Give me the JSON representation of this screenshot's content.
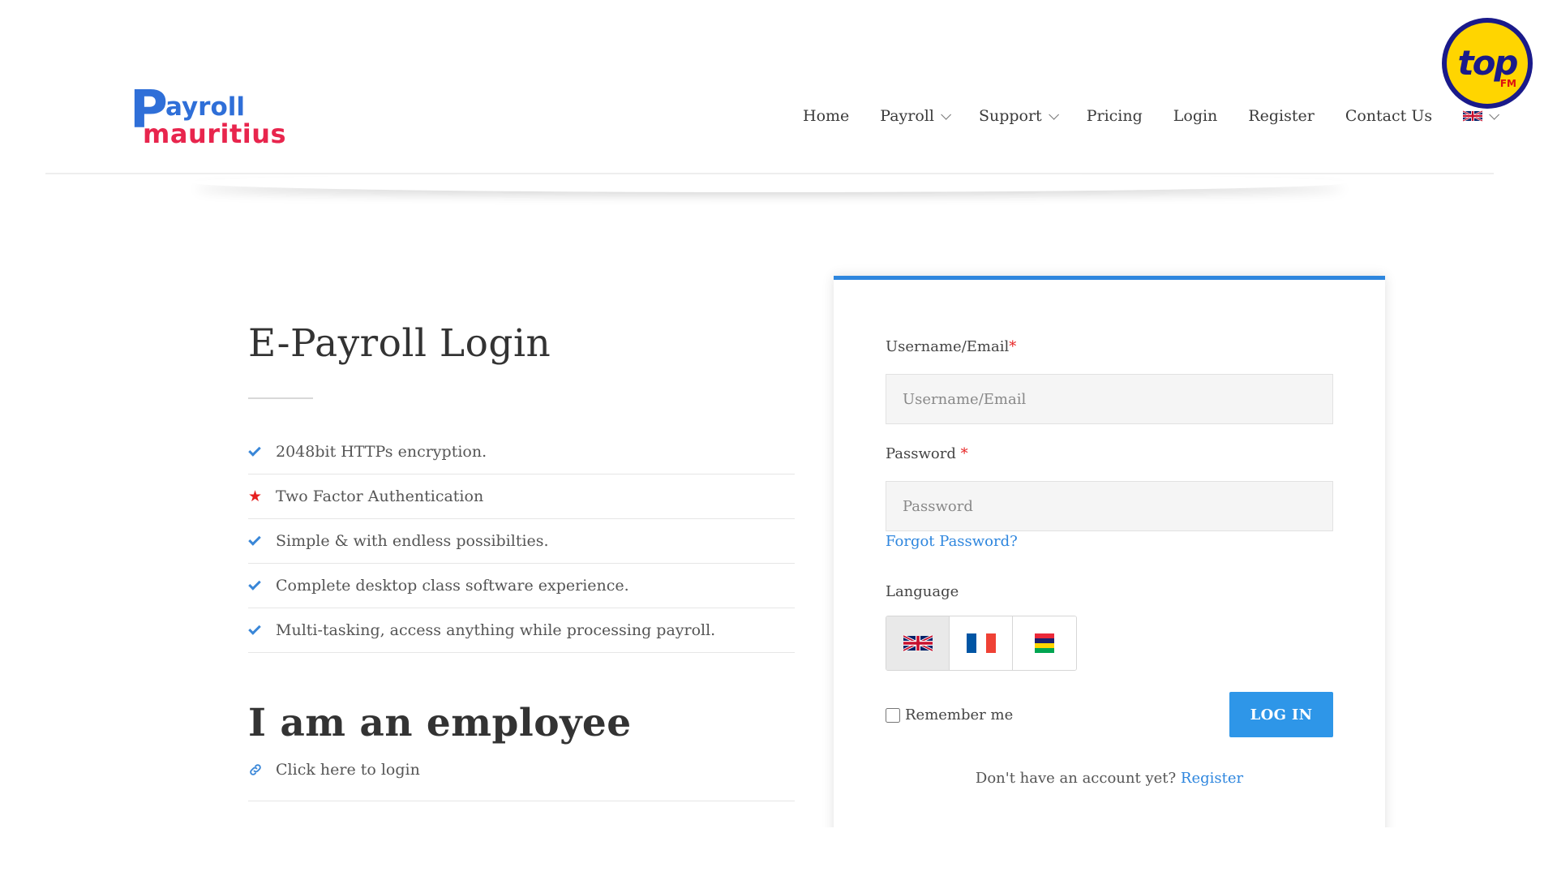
{
  "logo": {
    "letter": "P",
    "top_text": "ayroll",
    "bottom_text": "mauritius"
  },
  "nav": {
    "items": [
      {
        "label": "Home",
        "dropdown": false
      },
      {
        "label": "Payroll",
        "dropdown": true
      },
      {
        "label": "Support",
        "dropdown": true
      },
      {
        "label": "Pricing",
        "dropdown": false
      },
      {
        "label": "Login",
        "dropdown": false
      },
      {
        "label": "Register",
        "dropdown": false
      },
      {
        "label": "Contact Us",
        "dropdown": false
      }
    ],
    "language_flag": "uk-flag-icon"
  },
  "badge": {
    "text": "top",
    "subtext": "FM"
  },
  "left": {
    "title": "E-Payroll Login",
    "features": [
      {
        "icon": "check-icon",
        "text": "2048bit HTTPs encryption."
      },
      {
        "icon": "star-icon",
        "text": "Two Factor Authentication"
      },
      {
        "icon": "check-icon",
        "text": "Simple & with endless possibilties."
      },
      {
        "icon": "check-icon",
        "text": "Complete desktop class software experience."
      },
      {
        "icon": "check-icon",
        "text": "Multi-tasking, access anything while processing payroll."
      }
    ],
    "employee_title": "I am an employee",
    "employee_link": "Click here to login"
  },
  "form": {
    "username_label": "Username/Email",
    "username_placeholder": "Username/Email",
    "password_label": "Password",
    "password_placeholder": "Password",
    "required_mark": "*",
    "forgot_password": "Forgot Password?",
    "language_label": "Language",
    "languages": [
      "uk-flag-icon",
      "france-flag-icon",
      "mauritius-flag-icon"
    ],
    "remember_me": "Remember me",
    "login_button": "LOG IN",
    "no_account_text": "Don't have an account yet?",
    "register_link": "Register"
  },
  "colors": {
    "accent": "#2e86de",
    "button": "#2e96e8",
    "logo_blue": "#2f6fd8",
    "logo_red": "#e8254d",
    "required": "#e62020"
  }
}
